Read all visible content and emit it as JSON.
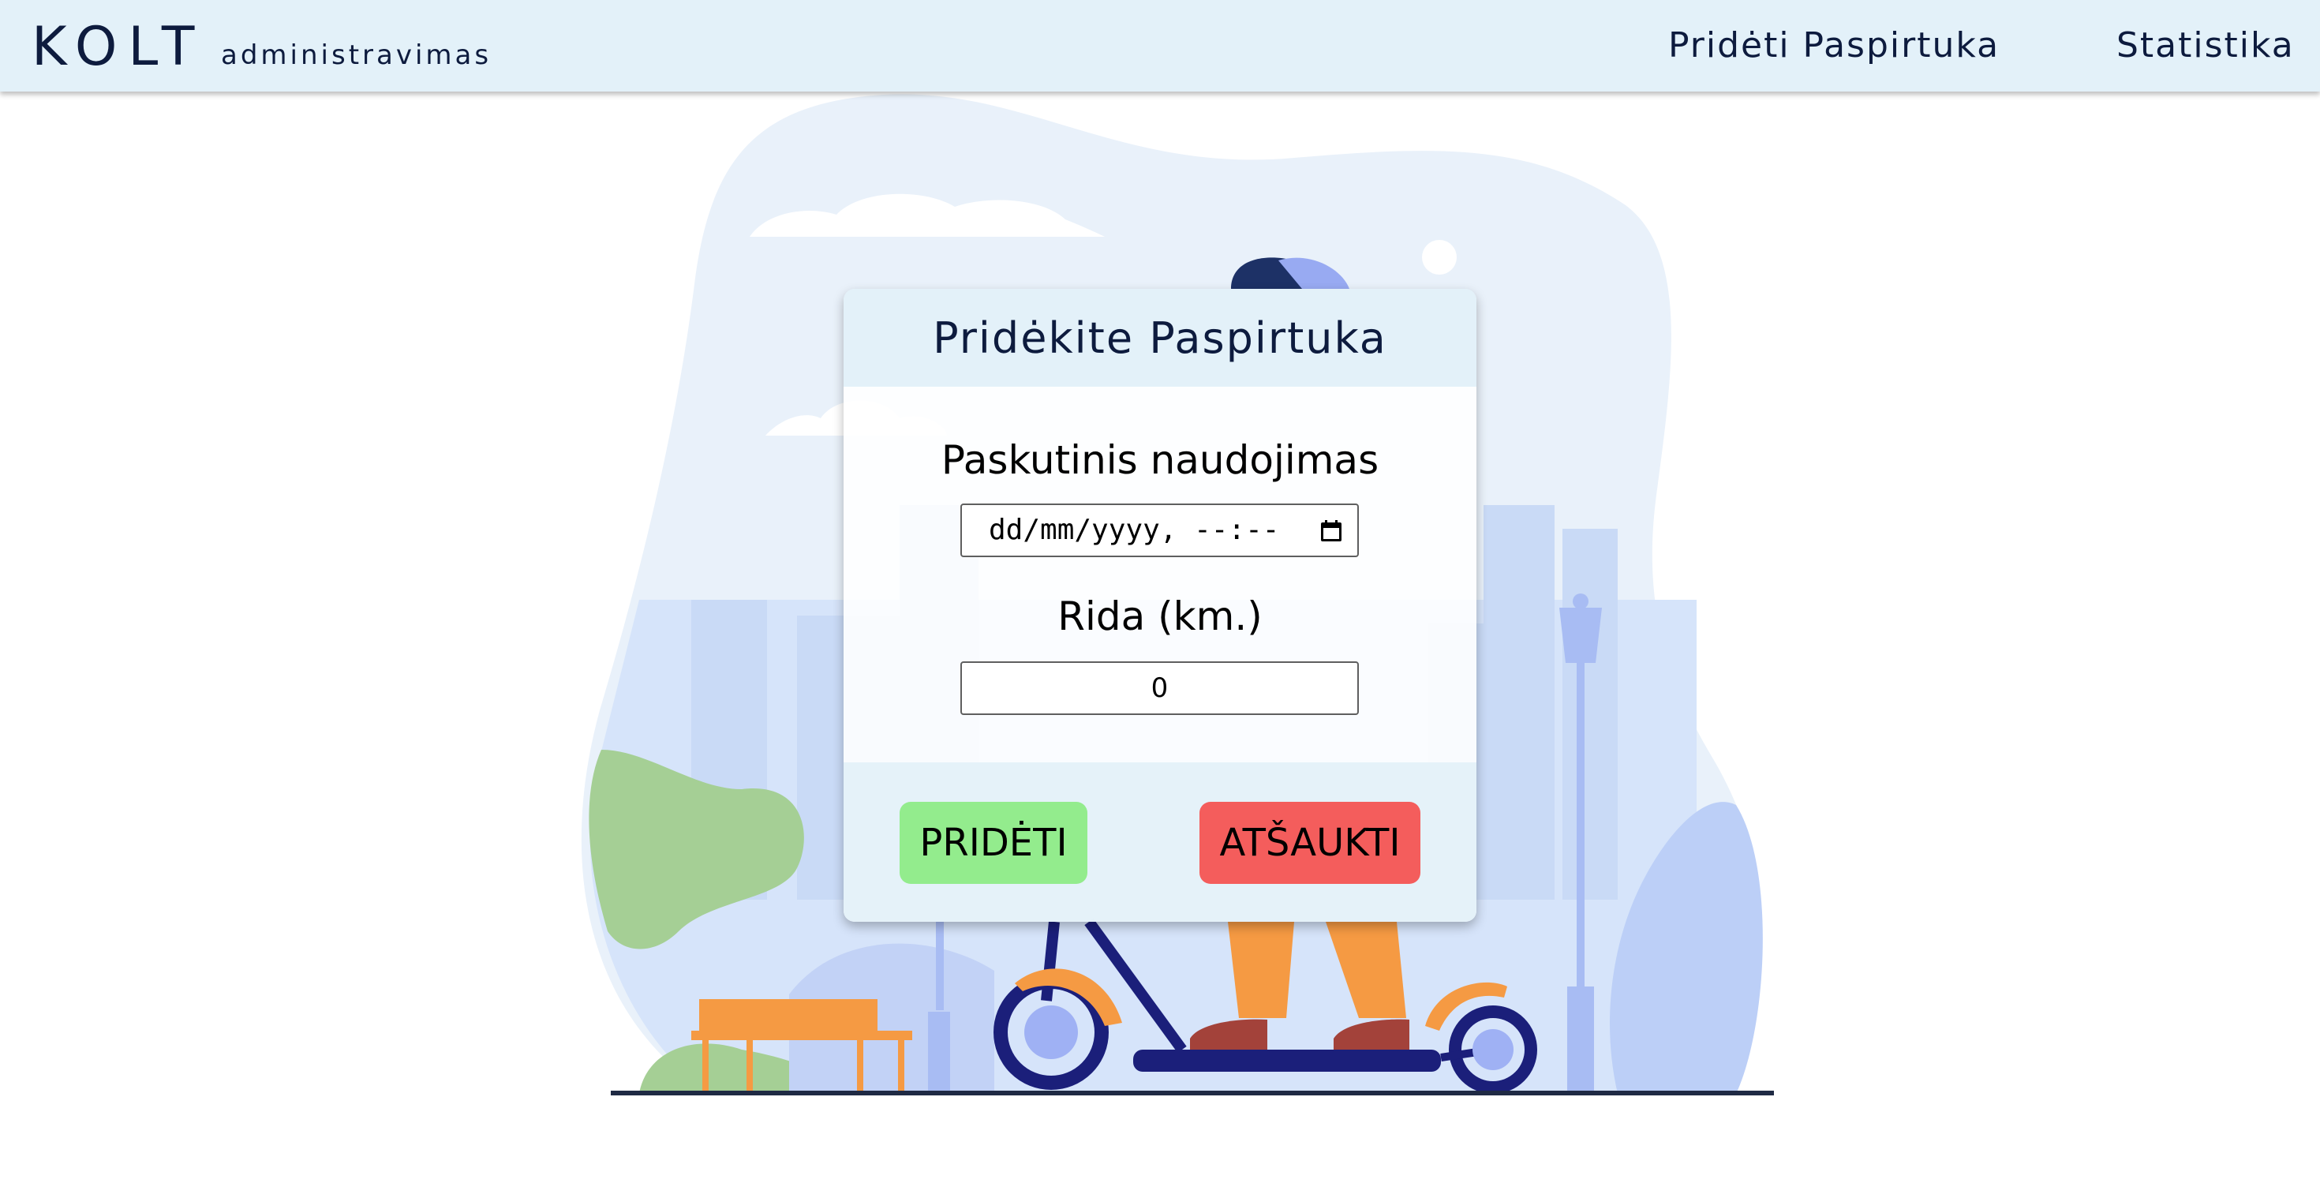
{
  "header": {
    "brand": "KOLT",
    "brand_subtitle": "administravimas",
    "nav": {
      "add_scooter": "Pridėti Paspirtuka",
      "statistics": "Statistika"
    }
  },
  "modal": {
    "title": "Pridėkite Paspirtuka",
    "last_use": {
      "label": "Paskutinis naudojimas",
      "placeholder": "dd/mm/yyyy, --:--"
    },
    "mileage": {
      "label": "Rida (km.)",
      "value": "0"
    },
    "buttons": {
      "add": "PRIDĖTI",
      "cancel": "ATŠAUKTI"
    }
  },
  "colors": {
    "header_bg": "#e3f1f9",
    "brand_text": "#0d1b3e",
    "add_button": "#93ec8d",
    "cancel_button": "#f45d5c",
    "accent_orange": "#f59a43",
    "scooter_navy": "#1b1f7a"
  },
  "icons": {
    "calendar": "calendar-icon"
  }
}
